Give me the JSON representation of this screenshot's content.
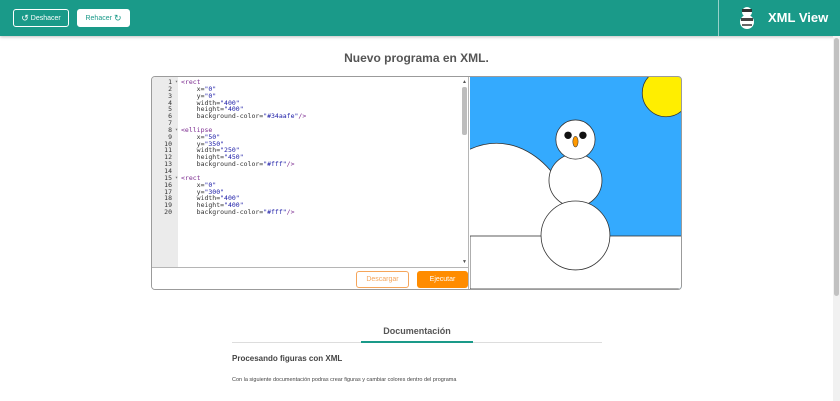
{
  "header": {
    "undo_label": "Deshacer",
    "redo_label": "Rehacer",
    "brand": "XML View",
    "background": "#1a9a89"
  },
  "title": "Nuevo programa en XML.",
  "editor": {
    "lines": [
      {
        "n": "1",
        "fold": true,
        "text": "<rect"
      },
      {
        "n": "2",
        "text": "    x=\"0\""
      },
      {
        "n": "3",
        "text": "    y=\"0\""
      },
      {
        "n": "4",
        "text": "    width=\"400\""
      },
      {
        "n": "5",
        "text": "    height=\"400\""
      },
      {
        "n": "6",
        "text": "    background-color=\"#34aafe\"/>"
      },
      {
        "n": "7",
        "text": ""
      },
      {
        "n": "8",
        "fold": true,
        "text": "<ellipse"
      },
      {
        "n": "9",
        "text": "    x=\"50\""
      },
      {
        "n": "10",
        "text": "    y=\"350\""
      },
      {
        "n": "11",
        "text": "    width=\"250\""
      },
      {
        "n": "12",
        "text": "    height=\"450\""
      },
      {
        "n": "13",
        "text": "    background-color=\"#fff\"/>"
      },
      {
        "n": "14",
        "text": ""
      },
      {
        "n": "15",
        "fold": true,
        "text": "<rect"
      },
      {
        "n": "16",
        "text": "    x=\"0\""
      },
      {
        "n": "17",
        "text": "    y=\"300\""
      },
      {
        "n": "18",
        "text": "    width=\"400\""
      },
      {
        "n": "19",
        "text": "    height=\"400\""
      },
      {
        "n": "20",
        "text": "    background-color=\"#fff\"/>"
      }
    ],
    "download_label": "Descargar",
    "run_label": "Ejecutar"
  },
  "colors": {
    "sky": "#34aafe",
    "sun": "#ffee00",
    "beak": "#ff9900",
    "accent": "#ff8c00"
  },
  "documentation": {
    "tab_label": "Documentación",
    "heading": "Procesando figuras con XML",
    "paragraph": "Con la siguiente documentación podras crear figuras y cambiar colores dentro del programa"
  }
}
